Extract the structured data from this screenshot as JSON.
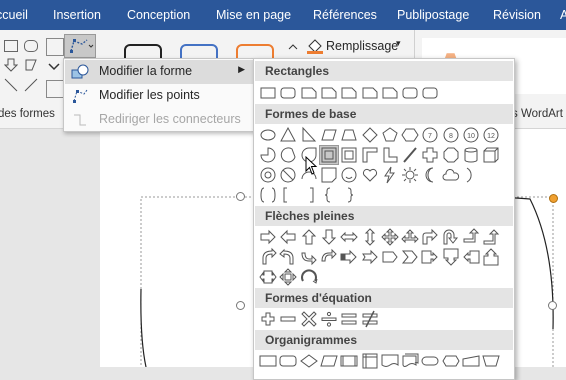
{
  "tabs": [
    "ccueil",
    "Insertion",
    "Conception",
    "Mise en page",
    "Références",
    "Publipostage",
    "Révision",
    "A"
  ],
  "ribbon": {
    "group_shapes_label": "des formes",
    "fill_label": "Remplissage",
    "wordart_label": "s WordArt"
  },
  "context_menu": {
    "items": [
      {
        "label": "Modifier la forme",
        "has_submenu": true,
        "highlighted": true
      },
      {
        "label": "Modifier les points",
        "enabled": true
      },
      {
        "label": "Rediriger les connecteurs",
        "enabled": false
      }
    ]
  },
  "gallery": {
    "sections": [
      {
        "title": "Rectangles",
        "count": 9
      },
      {
        "title": "Formes de base",
        "count": 42,
        "selected_index": 3
      },
      {
        "title": "Flèches pleines",
        "count": 27
      },
      {
        "title": "Formes d'équation",
        "count": 6
      },
      {
        "title": "Organigrammes",
        "count": 12
      }
    ]
  },
  "colors": {
    "ribbon_tab_bg": "#2b579a",
    "wordart_orange": "#f4b183",
    "selection_handle": "#f0a030"
  }
}
